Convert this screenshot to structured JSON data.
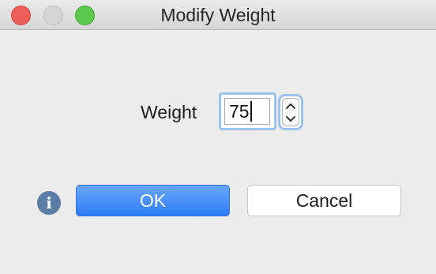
{
  "window": {
    "title": "Modify Weight",
    "controls": [
      "close",
      "minimize",
      "zoom"
    ]
  },
  "form": {
    "weight_label": "Weight",
    "weight_value": "75"
  },
  "stepper": {
    "up_icon": "chevron-up-icon",
    "down_icon": "chevron-down-icon"
  },
  "buttons": {
    "ok_label": "OK",
    "cancel_label": "Cancel"
  },
  "info": {
    "icon": "info-icon",
    "glyph": "i"
  },
  "colors": {
    "accent": "#2c7cf6",
    "focus_ring": "#9cc2ee",
    "close": "#ee5f5a",
    "zoom": "#5cc94e",
    "info_icon": "#5b7ea7"
  }
}
